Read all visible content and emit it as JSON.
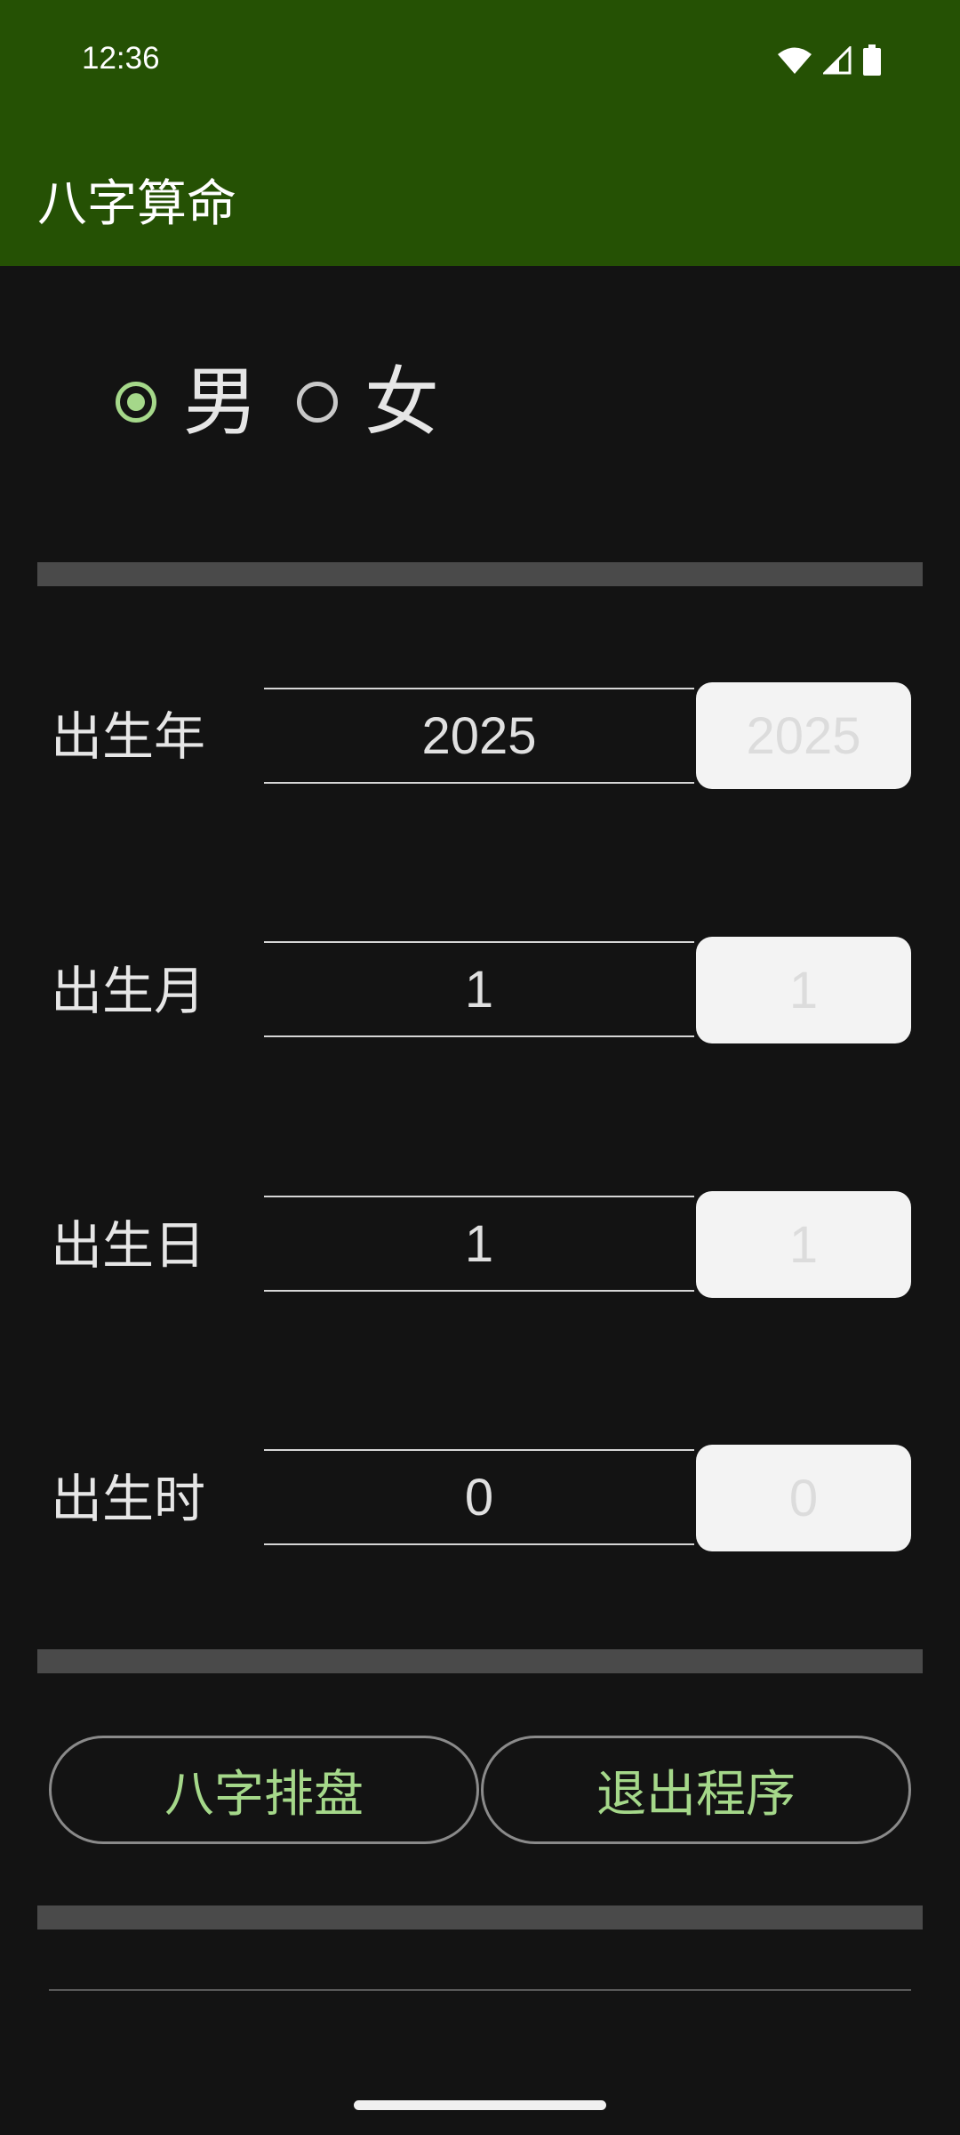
{
  "status_bar": {
    "time": "12:36",
    "icons": [
      "wifi-icon",
      "signal-icon",
      "battery-icon"
    ]
  },
  "app_bar": {
    "title": "八字算命",
    "color": "#255104"
  },
  "gender": {
    "options": [
      {
        "label": "男",
        "checked": true
      },
      {
        "label": "女",
        "checked": false
      }
    ],
    "accent": "#a5d88a"
  },
  "fields": [
    {
      "label": "出生年",
      "value": "2025",
      "echo": "2025"
    },
    {
      "label": "出生月",
      "value": "1",
      "echo": "1"
    },
    {
      "label": "出生日",
      "value": "1",
      "echo": "1"
    },
    {
      "label": "出生时",
      "value": "0",
      "echo": "0"
    }
  ],
  "buttons": {
    "chart_label": "八字排盘",
    "exit_label": "退出程序"
  }
}
